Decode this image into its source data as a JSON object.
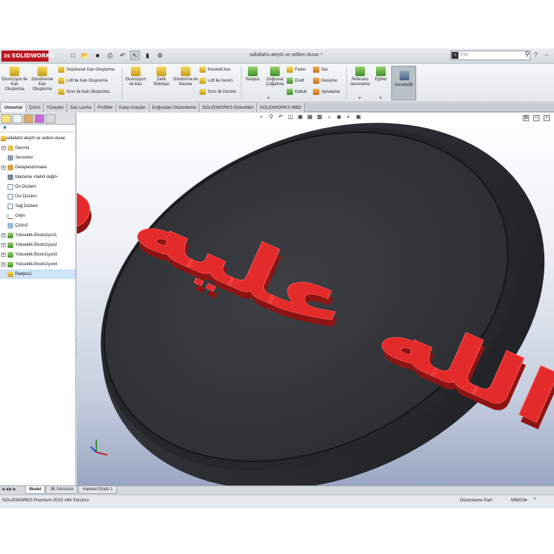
{
  "app": {
    "brand": "SOLIDWORKS",
    "brand_prefix": "3S",
    "doc_title": "sallallahü aleyhi ve sellem-duvar *",
    "search_placeholder": "Filtr"
  },
  "ribbon": {
    "big_buttons": [
      {
        "label": "Ekstrüzyon ile Katı Oluşturma",
        "icon": "extrude-boss-icon"
      },
      {
        "label": "Döndürerek Katı Oluşturma",
        "icon": "revolve-boss-icon"
      },
      {
        "label": "Ekstrüzyon ile Kes",
        "icon": "extrude-cut-icon"
      },
      {
        "label": "Delik Sihirbazı",
        "icon": "hole-wizard-icon"
      },
      {
        "label": "Döndürme ile Kesme",
        "icon": "revolve-cut-icon"
      }
    ],
    "small_col1": [
      "Süpürerek Katı Oluşturma",
      "Loft ile Katı Oluşturma",
      "Sınır ile Katı Oluşturma"
    ],
    "small_col2": [
      "Kesmeli Kes",
      "Loft ile Kesim",
      "Sınır ile Kesme"
    ],
    "radius": "Radyus",
    "linear_pattern": "Doğrusal Çoğaltma",
    "small_col3": [
      "Feder",
      "Draft",
      "Kabuk"
    ],
    "small_col4": [
      "Sar",
      "Kesişme",
      "Aynalama"
    ],
    "ref_geometry": "Referans Geometrisi",
    "curves": "Eğriler",
    "instant3d": "Anında3B"
  },
  "tabs": [
    "Unsurlar",
    "Çizim",
    "Yüzeyler",
    "Sac Levha",
    "Profiller",
    "Kalıp Araçları",
    "Doğrudan Düzenleme",
    "SOLIDWORKS Eklentileri",
    "SOLIDWORKS MBD"
  ],
  "feature_tree": [
    {
      "label": "sallallahü aleyhi ve sellem-duvar",
      "icon": "part-icon",
      "root": true
    },
    {
      "label": "Geçmiş",
      "icon": "history-folder-icon"
    },
    {
      "label": "Sensörler",
      "icon": "sensors-icon"
    },
    {
      "label": "Detaylandırmalar",
      "icon": "annotations-icon"
    },
    {
      "label": "Malzeme <belirli değil>",
      "icon": "material-icon"
    },
    {
      "label": "Ön Düzlem",
      "icon": "plane-icon"
    },
    {
      "label": "Üst Düzlem",
      "icon": "plane-icon"
    },
    {
      "label": "Sağ Düzlem",
      "icon": "plane-icon"
    },
    {
      "label": "Orijin",
      "icon": "origin-icon"
    },
    {
      "label": "Çizim2",
      "icon": "sketch-icon"
    },
    {
      "label": "Yükseklik-Ekstrüzyon1",
      "icon": "extrude-icon"
    },
    {
      "label": "Yükseklik-Ekstrüzyon2",
      "icon": "extrude-icon"
    },
    {
      "label": "Yükseklik-Ekstrüzyon3",
      "icon": "extrude-icon"
    },
    {
      "label": "Yükseklik-Ekstrüzyon4",
      "icon": "extrude-icon"
    },
    {
      "label": "Radyus1",
      "icon": "fillet-icon",
      "selected": true
    }
  ],
  "model": {
    "calligraphy": "صلى الله عليه وسلم",
    "disc_color": "#2e2f33",
    "text_color": "#e32b2b"
  },
  "bottom_tabs": [
    "Model",
    "3B Görünüm",
    "Hareket Etüdü 1"
  ],
  "status": {
    "left": "SOLIDWORKS Premium 2015 x64 Sürümü",
    "mode": "Düzenleme Part",
    "units": "MMGS"
  }
}
